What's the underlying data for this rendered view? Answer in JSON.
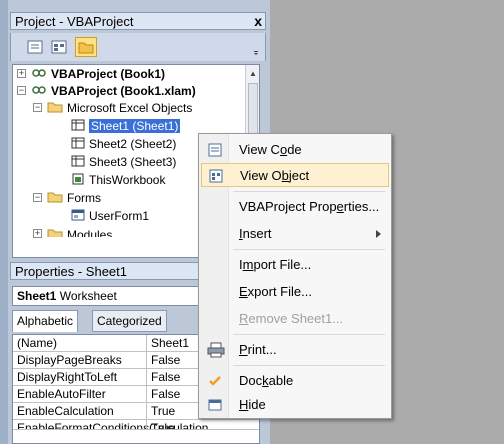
{
  "project_pane": {
    "title": "Project - VBAProject",
    "close_glyph": "x",
    "toolbar": [
      {
        "name": "view-code-tool-icon"
      },
      {
        "name": "view-object-tool-icon"
      },
      {
        "name": "toggle-folders-icon"
      }
    ],
    "tree": [
      {
        "label": "VBAProject (Book1)",
        "expander": "+"
      },
      {
        "label": "VBAProject (Book1.xlam)",
        "expander": "−"
      },
      {
        "label": "Microsoft Excel Objects",
        "expander": "−"
      },
      {
        "label": "Sheet1 (Sheet1)"
      },
      {
        "label": "Sheet2 (Sheet2)"
      },
      {
        "label": "Sheet3 (Sheet3)"
      },
      {
        "label": "ThisWorkbook"
      },
      {
        "label": "Forms",
        "expander": "−"
      },
      {
        "label": "UserForm1"
      },
      {
        "label": "Modules",
        "expander": "+"
      }
    ]
  },
  "properties_pane": {
    "title": "Properties - Sheet1",
    "object_name": "Sheet1",
    "object_type": "Worksheet",
    "tabs": [
      "Alphabetic",
      "Categorized"
    ],
    "rows": [
      {
        "key": "(Name)",
        "value": "Sheet1"
      },
      {
        "key": "DisplayPageBreaks",
        "value": "False"
      },
      {
        "key": "DisplayRightToLeft",
        "value": "False"
      },
      {
        "key": "EnableAutoFilter",
        "value": "False"
      },
      {
        "key": "EnableCalculation",
        "value": "True"
      },
      {
        "key": "EnableFormatConditionsCalculation",
        "value": "True"
      }
    ]
  },
  "context_menu": {
    "items": [
      {
        "pre": "View C",
        "ul": "o",
        "post": "de",
        "icon": "view-code-icon"
      },
      {
        "pre": "View O",
        "ul": "b",
        "post": "ject",
        "icon": "view-object-icon",
        "highlighted": true
      },
      {
        "pre": "VBAProject Prop",
        "ul": "e",
        "post": "rties..."
      },
      {
        "pre": "",
        "ul": "I",
        "post": "nsert",
        "submenu": true
      },
      {
        "pre": "I",
        "ul": "m",
        "post": "port File..."
      },
      {
        "pre": "",
        "ul": "E",
        "post": "xport File..."
      },
      {
        "pre": "",
        "ul": "R",
        "post": "emove Sheet1...",
        "disabled": true
      },
      {
        "pre": "",
        "ul": "P",
        "post": "rint...",
        "icon": "print-icon"
      },
      {
        "pre": "Doc",
        "ul": "k",
        "post": "able",
        "icon": "checkmark-icon",
        "checked": true
      },
      {
        "pre": "",
        "ul": "H",
        "post": "ide",
        "icon": "hide-icon"
      }
    ]
  },
  "colors": {
    "selection": "#3a6fd8",
    "menu_highlight": "#fdf1d2",
    "check_orange": "#f0a020"
  }
}
